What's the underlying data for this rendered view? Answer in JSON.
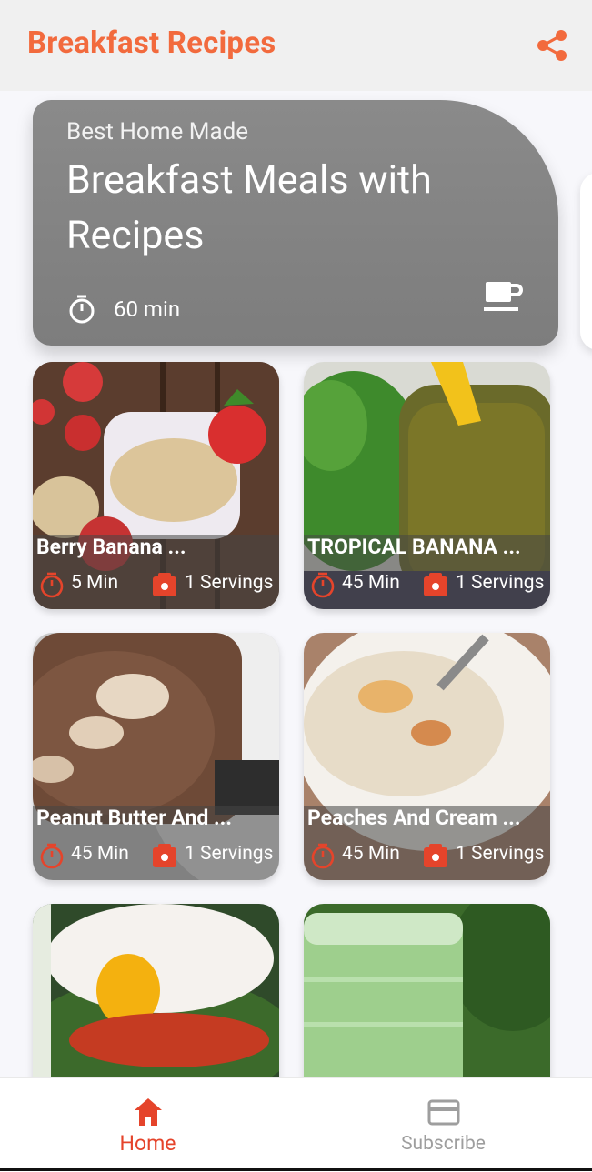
{
  "app": {
    "title": "Breakfast Recipes"
  },
  "colors": {
    "accent": "#f26a3d",
    "nav_active": "#e5442b",
    "nav_inactive": "#9e9e9e",
    "timer_icon": "#e5442b"
  },
  "hero": {
    "subtitle": "Best Home Made",
    "title": "Breakfast Meals with Recipes",
    "time": "60 min",
    "icons": [
      "timer-icon",
      "coffee-cup-icon"
    ]
  },
  "recipes": [
    {
      "name": "Berry Banana ...",
      "time": "5 Min",
      "servings": "1 Servings"
    },
    {
      "name": "TROPICAL BANANA ...",
      "time": "45 Min",
      "servings": "1 Servings"
    },
    {
      "name": "Peanut Butter And ...",
      "time": "45 Min",
      "servings": "1 Servings"
    },
    {
      "name": "Peaches And Cream ...",
      "time": "45 Min",
      "servings": "1 Servings"
    },
    {
      "name": "",
      "time": "",
      "servings": ""
    },
    {
      "name": "",
      "time": "",
      "servings": ""
    }
  ],
  "bottom_nav": {
    "items": [
      {
        "label": "Home",
        "icon": "home-icon",
        "active": true
      },
      {
        "label": "Subscribe",
        "icon": "credit-card-icon",
        "active": false
      }
    ]
  }
}
